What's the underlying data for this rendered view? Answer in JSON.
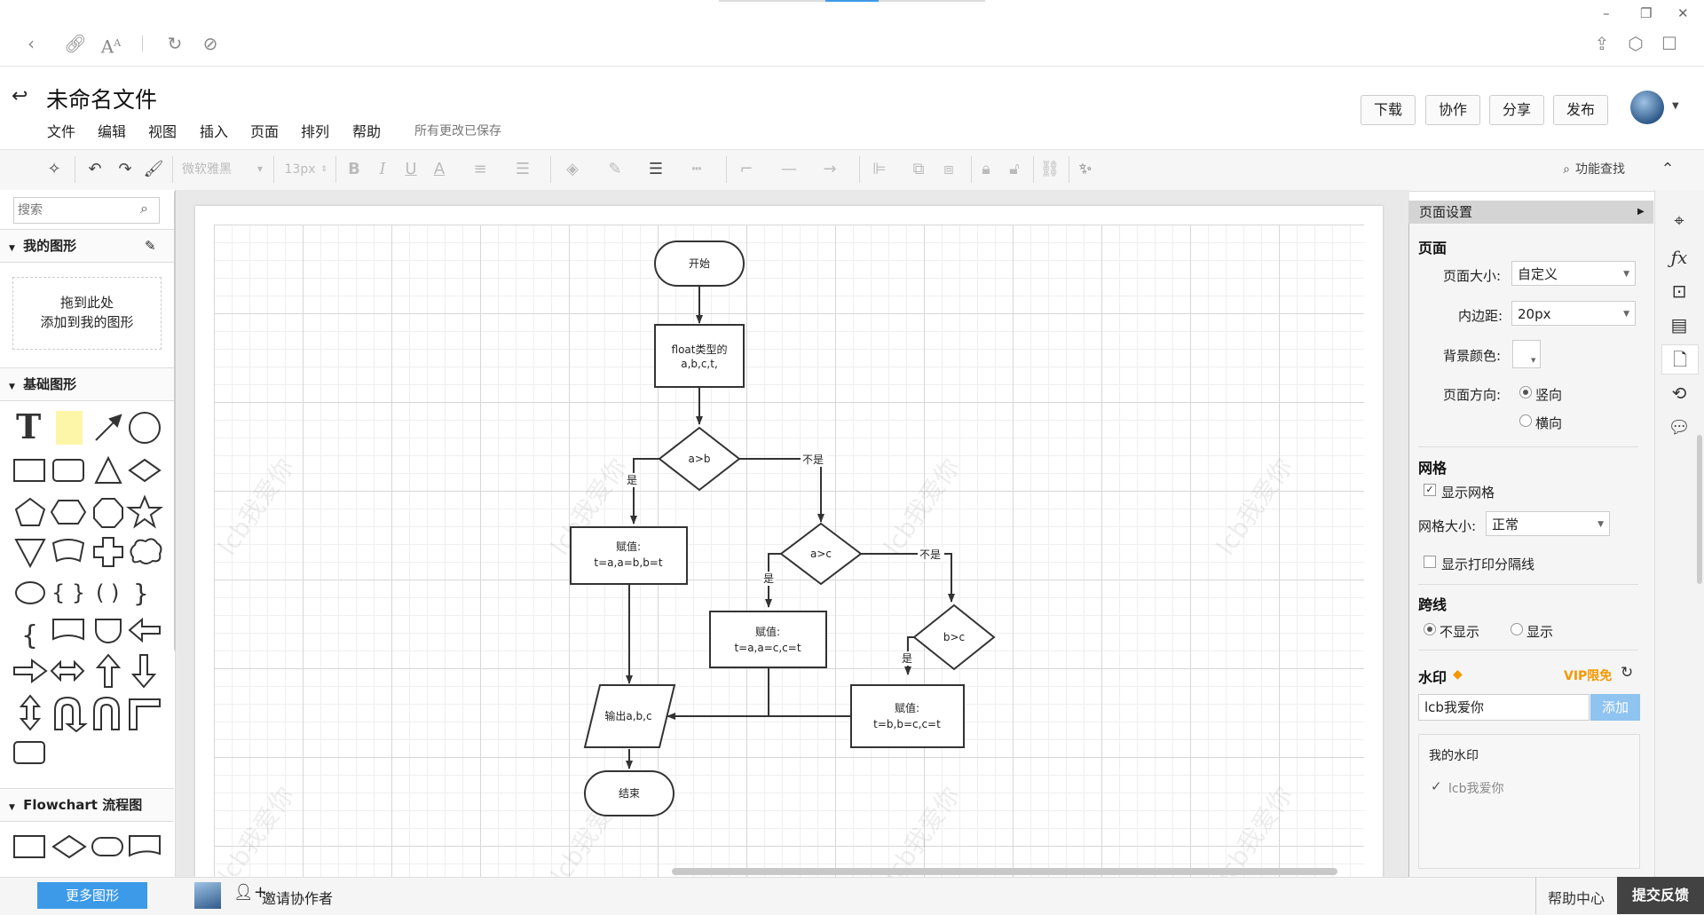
{
  "window": {
    "minimize": "–",
    "restore": "❐",
    "close": "✕"
  },
  "document": {
    "title": "未命名文件",
    "saved_status": "所有更改已保存"
  },
  "menu": [
    "文件",
    "编辑",
    "视图",
    "插入",
    "页面",
    "排列",
    "帮助"
  ],
  "header_buttons": {
    "download": "下载",
    "collaborate": "协作",
    "share": "分享",
    "publish": "发布"
  },
  "toolbar": {
    "font": "微软雅黑",
    "font_size": "13px",
    "search": "功能查找"
  },
  "left_panel": {
    "search_placeholder": "搜索",
    "my_shapes": "我的图形",
    "drop_hint_1": "拖到此处",
    "drop_hint_2": "添加到我的图形",
    "basic_shapes": "基础图形",
    "flowchart": "Flowchart 流程图",
    "more_shapes": "更多图形"
  },
  "flowchart": {
    "start": "开始",
    "step1_line1": "float类型的",
    "step1_line2": "a,b,c,t,",
    "cond1": "a>b",
    "cond2": "a>c",
    "cond3": "b>c",
    "yes": "是",
    "no": "不是",
    "assign_label": "赋值:",
    "assign1": "t=a,a=b,b=t",
    "assign2": "t=a,a=c,c=t",
    "assign3": "t=b,b=c,c=t",
    "output": "输出a,b,c",
    "end": "结束"
  },
  "watermark_text": "lcb我爱你",
  "page_settings": {
    "header": "页面设置",
    "page_section": "页面",
    "page_size_label": "页面大小:",
    "page_size_value": "自定义",
    "padding_label": "内边距:",
    "padding_value": "20px",
    "bg_color_label": "背景颜色:",
    "orientation_label": "页面方向:",
    "portrait": "竖向",
    "landscape": "横向",
    "grid_section": "网格",
    "show_grid": "显示网格",
    "grid_size_label": "网格大小:",
    "grid_size_value": "正常",
    "show_print_lines": "显示打印分隔线",
    "crossline_section": "跨线",
    "hide": "不显示",
    "show": "显示",
    "watermark_section": "水印",
    "vip": "VIP限免",
    "watermark_input": "lcb我爱你",
    "add_button": "添加",
    "my_watermarks": "我的水印",
    "watermark_item": "lcb我爱你"
  },
  "bottom": {
    "invite": "邀请协作者",
    "help_center": "帮助中心",
    "feedback": "提交反馈"
  },
  "colors": {
    "accent_blue": "#3d9ae8",
    "vip_orange": "#f39800",
    "feedback_bg": "#424242"
  }
}
